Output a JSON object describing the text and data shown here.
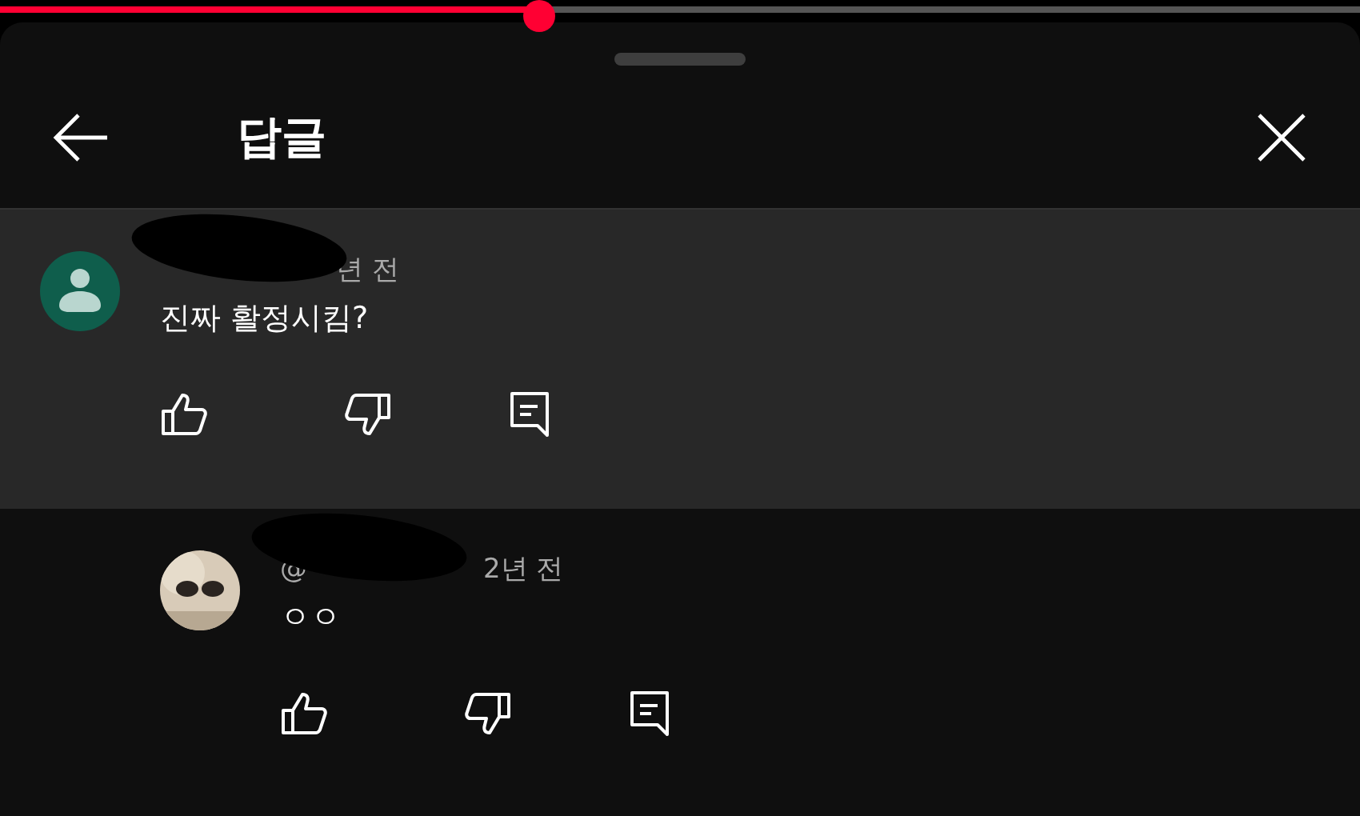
{
  "video_progress": {
    "level": 0.397
  },
  "header": {
    "title": "답글"
  },
  "comments": [
    {
      "kind": "default",
      "highlighted": true,
      "time": "년 전",
      "text": "진짜 활정시킴?"
    },
    {
      "kind": "picture",
      "highlighted": false,
      "handle": "@",
      "time": "2년 전",
      "text": "ㅇㅇ"
    }
  ]
}
